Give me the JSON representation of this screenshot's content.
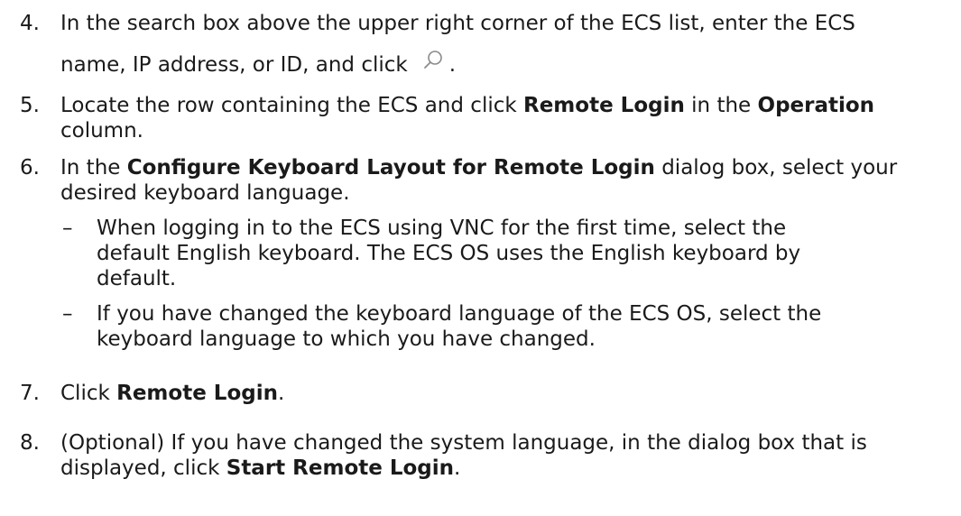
{
  "steps": [
    {
      "number": "4.",
      "line1": "In the search box above the upper right corner of the ECS list, enter the ECS",
      "line2_pre": "name, IP address, or ID, and click",
      "line2_post": "."
    },
    {
      "number": "5.",
      "pre": "Locate the row containing the ECS and click ",
      "bold1": "Remote Login",
      "mid": " in the ",
      "bold2": "Operation",
      "line2": "column."
    },
    {
      "number": "6.",
      "pre": "In the ",
      "bold": "Configure Keyboard Layout for Remote Login",
      "post": " dialog box, select your",
      "line2": "desired keyboard language.",
      "bullets": [
        {
          "dash": "–",
          "lines": [
            "When logging in to the ECS using VNC for the first time, select the",
            "default English keyboard. The ECS OS uses the English keyboard by",
            "default."
          ]
        },
        {
          "dash": "–",
          "lines": [
            "If you have changed the keyboard language of the ECS OS, select the",
            "keyboard language to which you have changed."
          ]
        }
      ]
    },
    {
      "number": "7.",
      "pre": "Click ",
      "bold": "Remote Login",
      "post": "."
    },
    {
      "number": "8.",
      "line1": "(Optional) If you have changed the system language, in the dialog box that is",
      "line2_pre": "displayed, click ",
      "bold": "Start Remote Login",
      "line2_post": "."
    }
  ],
  "icons": {
    "search": "search-icon"
  }
}
